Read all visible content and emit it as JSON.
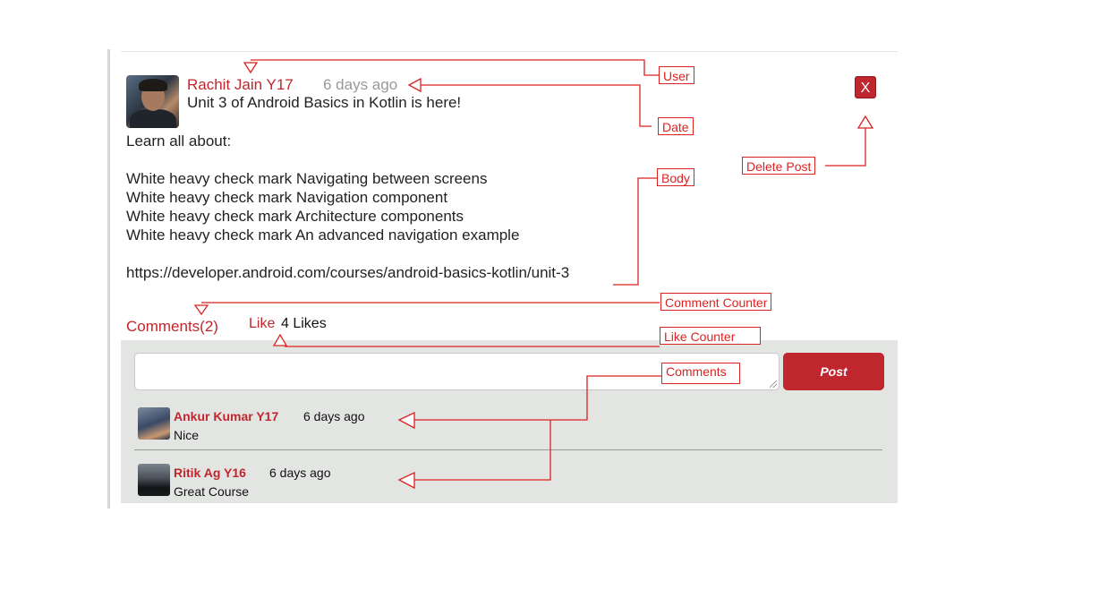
{
  "post": {
    "user_name": "Rachit Jain Y17",
    "date": "6 days ago",
    "title": "Unit 3 of Android Basics in Kotlin is here!",
    "body_lines": [
      "Learn all about:",
      "",
      "White heavy check mark Navigating between screens",
      "White heavy check mark Navigation component",
      "White heavy check mark Architecture components",
      "White heavy check mark An advanced navigation example",
      "",
      "https://developer.android.com/courses/android-basics-kotlin/unit-3"
    ],
    "delete_label": "X",
    "comments_counter": "Comments(2)",
    "like_label": "Like",
    "like_count": "4 Likes"
  },
  "comment_form": {
    "input_value": "",
    "post_label": "Post"
  },
  "comments": [
    {
      "name": "Ankur Kumar Y17",
      "date": "6 days ago",
      "text": "Nice"
    },
    {
      "name": "Ritik Ag Y16",
      "date": "6 days ago",
      "text": "Great Course"
    }
  ],
  "annotations": {
    "user": "User",
    "date": "Date",
    "body": "Body",
    "delete_post": "Delete Post",
    "comment_counter": "Comment Counter",
    "like_counter": "Like Counter",
    "comments": "Comments"
  },
  "colors": {
    "accent": "#c0262d",
    "annotation": "#dd2222",
    "comment_bg": "#e3e5e3"
  }
}
